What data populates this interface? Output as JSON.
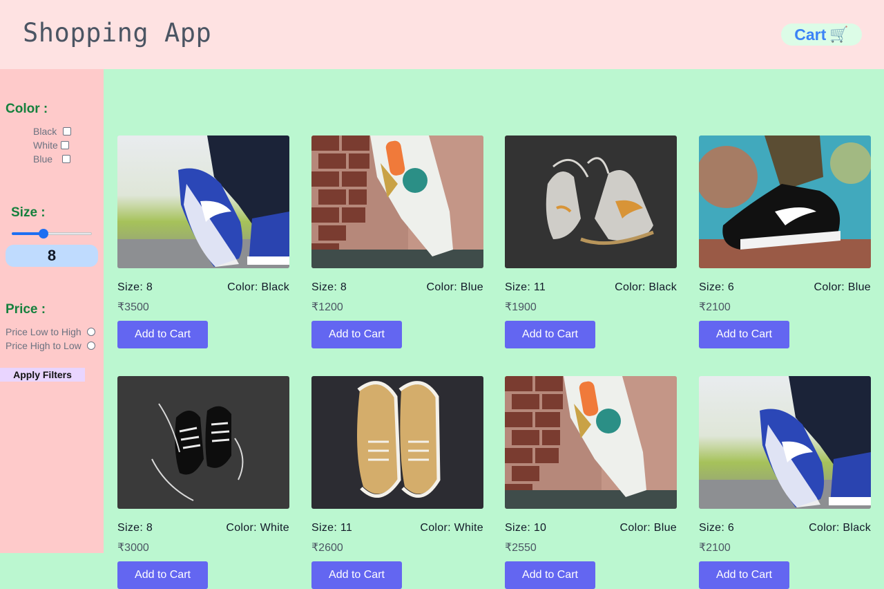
{
  "header": {
    "title": "Shopping App",
    "cart_label": "Cart",
    "cart_icon": "🛒"
  },
  "filters": {
    "color": {
      "title": "Color :",
      "options": [
        "Black",
        "White",
        "Blue"
      ]
    },
    "size": {
      "title": "Size :",
      "value": "8",
      "slider_fraction": 0.4
    },
    "price": {
      "title": "Price :",
      "options": [
        "Price Low to High",
        "Price High to Low"
      ]
    },
    "apply_label": "Apply Filters"
  },
  "products": [
    {
      "size": "Size: 8",
      "color": "Color: Black",
      "price": "₹3500",
      "button": "Add to Cart",
      "image": "blue-sneaker-on-grass"
    },
    {
      "size": "Size: 8",
      "color": "Color: Blue",
      "price": "₹1200",
      "button": "Add to Cart",
      "image": "white-sneaker-brick-wall"
    },
    {
      "size": "Size: 11",
      "color": "Color: Black",
      "price": "₹1900",
      "button": "Add to Cart",
      "image": "grey-high-tops-dark-background"
    },
    {
      "size": "Size: 6",
      "color": "Color: Blue",
      "price": "₹2100",
      "button": "Add to Cart",
      "image": "black-sneaker-graffiti"
    },
    {
      "size": "Size: 8",
      "color": "Color: White",
      "price": "₹3000",
      "button": "Add to Cart",
      "image": "black-sneakers-grey-floor"
    },
    {
      "size": "Size: 11",
      "color": "Color: White",
      "price": "₹2600",
      "button": "Add to Cart",
      "image": "tan-vans-dark-background"
    },
    {
      "size": "Size: 10",
      "color": "Color: Blue",
      "price": "₹2550",
      "button": "Add to Cart",
      "image": "white-sneaker-brick-wall"
    },
    {
      "size": "Size: 6",
      "color": "Color: Black",
      "price": "₹2100",
      "button": "Add to Cart",
      "image": "blue-sneaker-on-grass"
    }
  ]
}
